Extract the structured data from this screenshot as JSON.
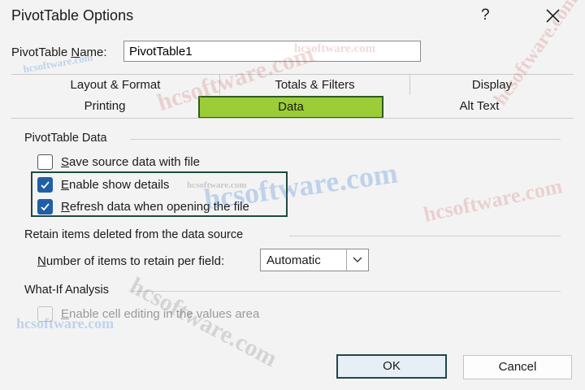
{
  "window": {
    "title": "PivotTable Options",
    "help_label": "?"
  },
  "name_field": {
    "label_pre": "PivotTable ",
    "label_mnemonic": "N",
    "label_post": "ame:",
    "value": "PivotTable1"
  },
  "tabs": {
    "row1": [
      {
        "label": "Layout & Format"
      },
      {
        "label": "Totals & Filters"
      },
      {
        "label": "Display"
      }
    ],
    "row2": [
      {
        "label": "Printing"
      },
      {
        "label": "Data",
        "active": true
      },
      {
        "label": "Alt Text"
      }
    ]
  },
  "data_tab": {
    "section1": {
      "title": "PivotTable Data",
      "items": [
        {
          "mnemonic": "S",
          "rest": "ave source data with file",
          "checked": false,
          "enabled": true
        },
        {
          "mnemonic": "E",
          "rest": "nable show details",
          "checked": true,
          "enabled": true
        },
        {
          "mnemonic": "R",
          "rest": "efresh data when opening the file",
          "checked": true,
          "enabled": true
        }
      ]
    },
    "section2": {
      "title": "Retain items deleted from the data source",
      "field_label_mnemonic": "N",
      "field_label_rest": "umber of items to retain per field:",
      "select_value": "Automatic"
    },
    "section3": {
      "title": "What-If Analysis",
      "item_mnemonic": "E",
      "item_rest": "nable cell editing in the values area",
      "checked": false,
      "enabled": false
    }
  },
  "buttons": {
    "ok": "OK",
    "cancel": "Cancel"
  },
  "watermarks": [
    "hcsoftware.com",
    "hcsoftware.com",
    "hcsoftware.com",
    "hcsoftware.com",
    "hcsoftware.com",
    "hcsoftware.com",
    "hcsoftware.com",
    "hcsoftware.com",
    "hcsoftware.com"
  ],
  "colors": {
    "active_tab": "#9ccc38",
    "checkbox_checked": "#1f5fa8",
    "highlight_border": "#1f4a3e"
  }
}
